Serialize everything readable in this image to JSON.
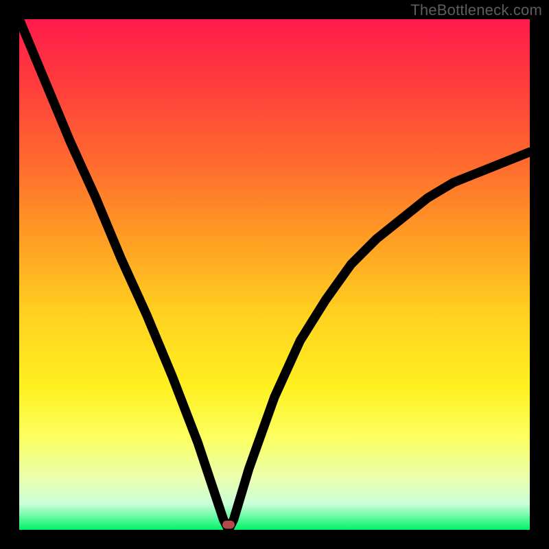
{
  "watermark": "TheBottleneck.com",
  "chart_data": {
    "type": "line",
    "title": "",
    "xlabel": "",
    "ylabel": "",
    "xlim": [
      0,
      100
    ],
    "ylim": [
      0,
      100
    ],
    "grid": false,
    "legend": false,
    "series": [
      {
        "name": "curve",
        "x": [
          0,
          5,
          10,
          15,
          20,
          25,
          30,
          35,
          38,
          40,
          41,
          42,
          45,
          50,
          55,
          60,
          65,
          70,
          75,
          80,
          85,
          90,
          95,
          100
        ],
        "y": [
          100,
          88,
          76,
          65,
          53,
          42,
          30,
          17,
          8,
          2,
          0,
          2,
          12,
          26,
          37,
          45,
          52,
          57,
          61,
          65,
          68,
          70,
          72,
          74
        ]
      }
    ],
    "marker": {
      "x": 41,
      "y": 0,
      "shape": "rounded-rect",
      "color": "#b24a4a"
    },
    "background_gradient": {
      "top": "#ff1a4b",
      "bottom": "#00f36a"
    }
  }
}
